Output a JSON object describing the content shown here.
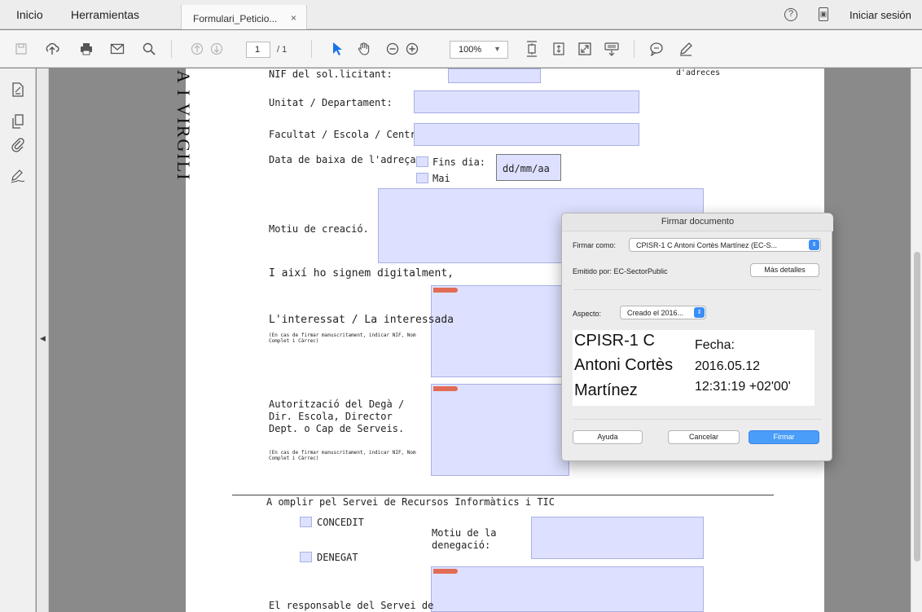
{
  "tabbar": {
    "home": "Inicio",
    "tools": "Herramientas",
    "doc_tab": "Formulari_Peticio...",
    "close": "×",
    "help": "?",
    "mobile": "▣",
    "signin": "Iniciar sesión"
  },
  "toolbar": {
    "page_current": "1",
    "page_total": "/ 1",
    "zoom": "100%",
    "icons": [
      "save-icon",
      "upload-icon",
      "print-icon",
      "mail-icon",
      "search-icon",
      "page-up-icon",
      "page-down-icon",
      "select-icon",
      "hand-icon",
      "zoom-out-icon",
      "zoom-in-icon",
      "fit-page-icon",
      "scroll-icon",
      "fullscreen-icon",
      "keyboard-icon",
      "comment-icon",
      "pen-icon"
    ]
  },
  "rail": {
    "icons": [
      "fill-sign-icon",
      "copy-pages-icon",
      "attachment-icon",
      "sign-icon"
    ]
  },
  "form": {
    "vertical_title": "A I VIRGILI",
    "nif_label": "NIF del sol.licitant:",
    "address_fragment": "d'adreces",
    "unit_label": "Unitat / Departament:",
    "faculty_label": "Facultat / Escola / Centre:",
    "date_label": "Data de baixa de l'adreça:",
    "fins_dia": "Fins dia:",
    "mai": "Mai",
    "date_placeholder": "dd/mm/aa",
    "motiu_label": "Motiu de creació.",
    "sign_statement": "I així ho signem digitalment,",
    "interessat_label": "L'interessat / La interessada",
    "interessat_note": "(En cas de firmar manuscritament, indicar NIF, Nom Complet i Càrrec)",
    "autoritzacio_label": "Autorització del Degà / Dir. Escola, Director Dept. o Cap de Serveis.",
    "autoritzacio_note": "(En cas de firmar manuscritament, indicar NIF, Nom Complet i Càrrec)",
    "section_title": "A omplir pel Servei de Recursos Informàtics i TIC",
    "concedit": "CONCEDIT",
    "denegat": "DENEGAT",
    "motiu_denegacio": "Motiu de la denegació:",
    "responsable": "El responsable del Servei de"
  },
  "dialog": {
    "title": "Firmar documento",
    "sign_as_label": "Firmar como:",
    "sign_as_value": "CPISR-1 C Antoni Cortès Martínez (EC-S...",
    "issued_by": "Emitido por: EC-SectorPublic",
    "more_details": "Más detalles",
    "aspect_label": "Aspecto:",
    "aspect_value": "Creado el 2016...",
    "preview_name_1": "CPISR-1 C",
    "preview_name_2": "Antoni Cortès",
    "preview_name_3": "Martínez",
    "preview_date_label": "Fecha:",
    "preview_date": "2016.05.12",
    "preview_time": "12:31:19 +02'00'",
    "help_button": "Ayuda",
    "cancel_button": "Cancelar",
    "sign_button": "Firmar"
  },
  "colors": {
    "field": "#dde1ff",
    "primary": "#4a9df8",
    "select_tool": "#1a73e8"
  }
}
